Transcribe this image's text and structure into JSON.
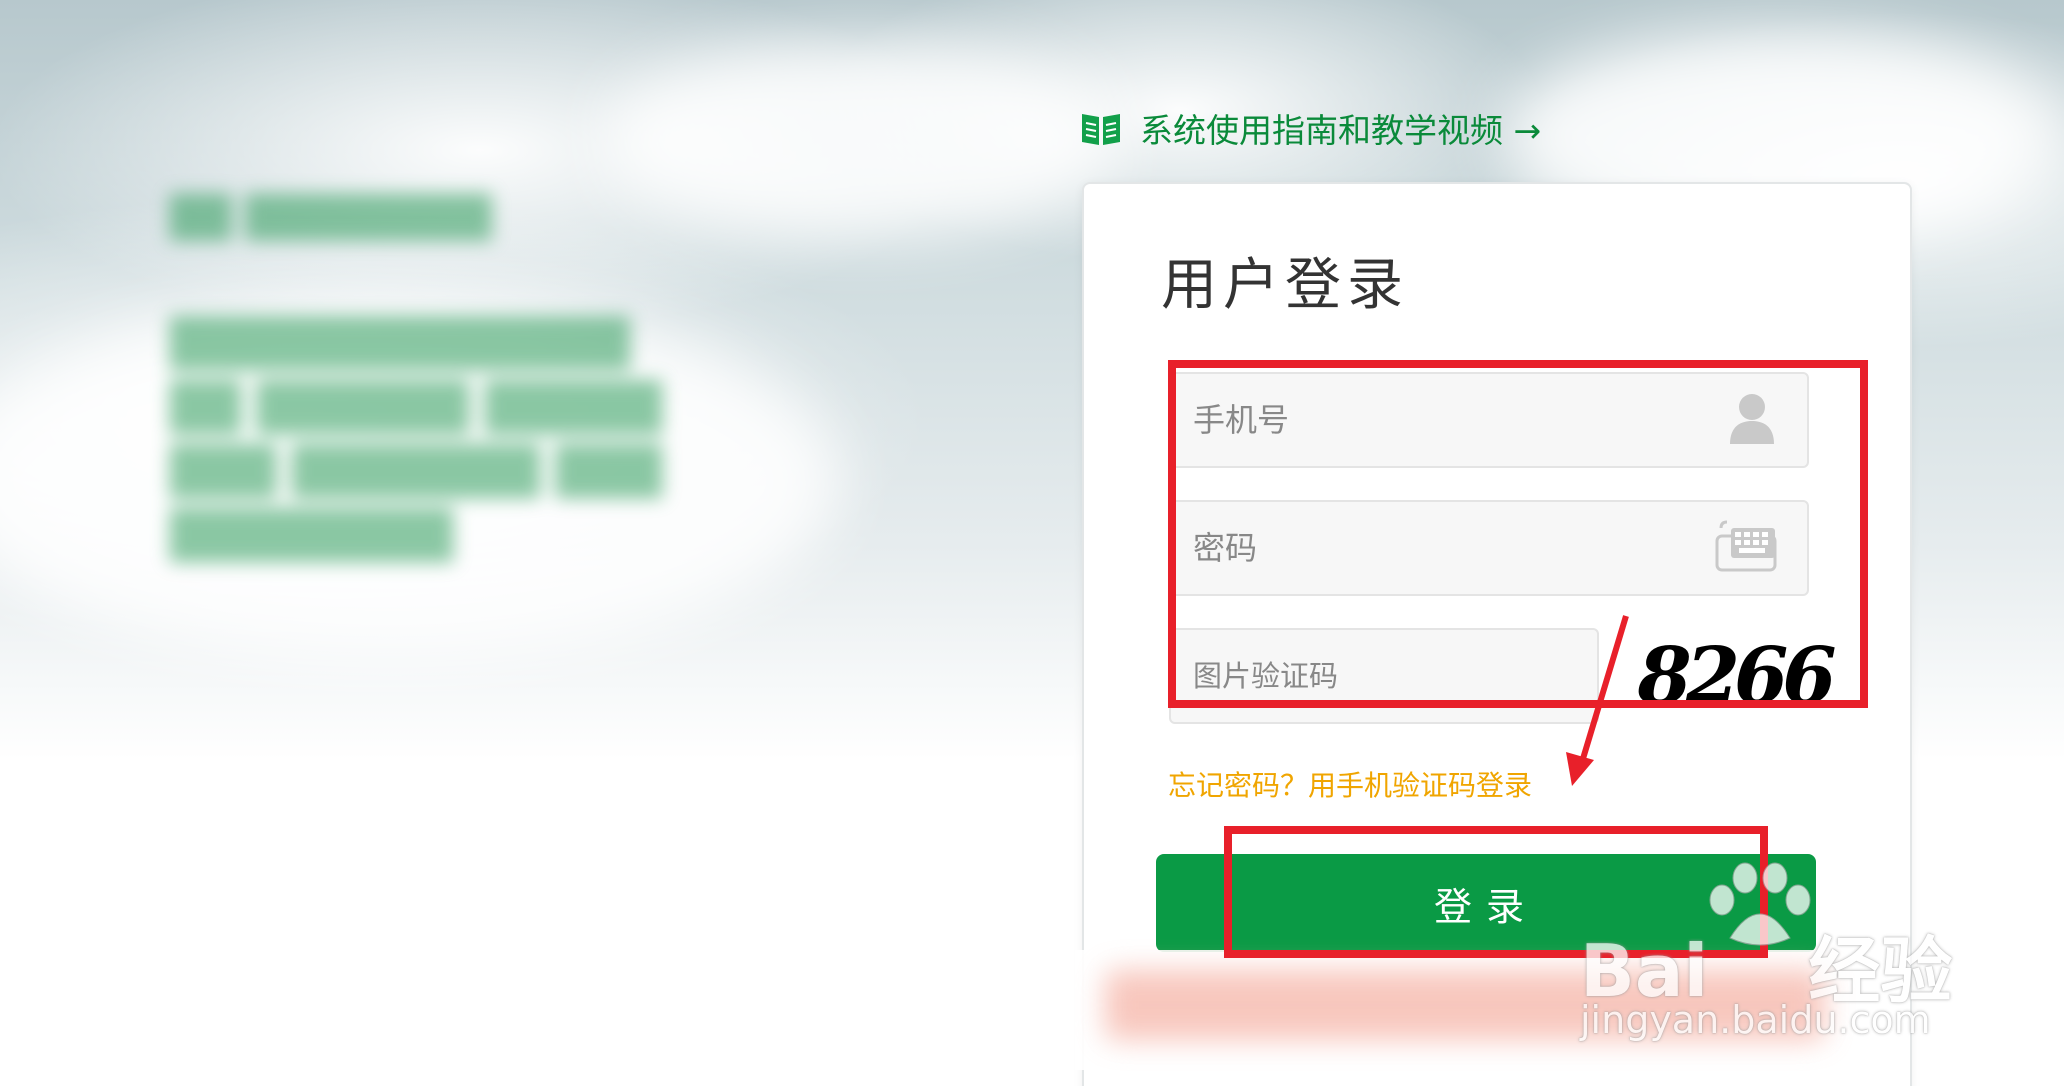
{
  "guide": {
    "link_label": "系统使用指南和教学视频 →"
  },
  "login": {
    "title": "用户登录",
    "phone_placeholder": "手机号",
    "password_placeholder": "密码",
    "captcha_placeholder": "图片验证码",
    "captcha_text": "8266",
    "forgot_link": "忘记密码？用手机验证码登录",
    "submit_label": "登录"
  },
  "watermark": {
    "logo": "Bai du 经验",
    "url": "jingyan.baidu.com"
  },
  "colors": {
    "brand_green": "#0a9a45",
    "link_orange": "#f0a500",
    "annotation_red": "#e8202a"
  }
}
